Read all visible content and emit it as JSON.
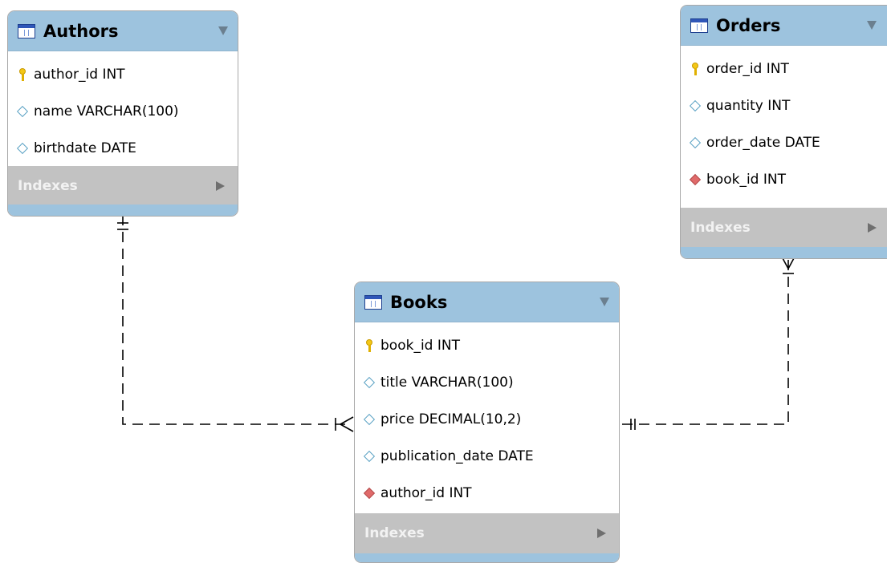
{
  "tables": {
    "authors": {
      "title": "Authors",
      "columns": [
        {
          "text": "author_id INT",
          "kind": "primary-key"
        },
        {
          "text": "name VARCHAR(100)",
          "kind": "column"
        },
        {
          "text": "birthdate DATE",
          "kind": "column"
        }
      ],
      "indexes_label": "Indexes"
    },
    "orders": {
      "title": "Orders",
      "columns": [
        {
          "text": "order_id INT",
          "kind": "primary-key"
        },
        {
          "text": "quantity INT",
          "kind": "column"
        },
        {
          "text": "order_date DATE",
          "kind": "column"
        },
        {
          "text": "book_id INT",
          "kind": "foreign-key"
        }
      ],
      "indexes_label": "Indexes"
    },
    "books": {
      "title": "Books",
      "columns": [
        {
          "text": "book_id INT",
          "kind": "primary-key"
        },
        {
          "text": "title VARCHAR(100)",
          "kind": "column"
        },
        {
          "text": "price DECIMAL(10,2)",
          "kind": "column"
        },
        {
          "text": "publication_date DATE",
          "kind": "column"
        },
        {
          "text": "author_id INT",
          "kind": "foreign-key"
        }
      ],
      "indexes_label": "Indexes"
    }
  },
  "relationships": [
    {
      "from": "authors",
      "to": "books",
      "from_cardinality": "one",
      "to_cardinality": "one-or-many"
    },
    {
      "from": "books",
      "to": "orders",
      "from_cardinality": "one-and-only-one",
      "to_cardinality": "one-or-many"
    }
  ],
  "colors": {
    "header": "#9dc3de",
    "indexes_bar": "#c2c2c2",
    "line": "#000000"
  }
}
